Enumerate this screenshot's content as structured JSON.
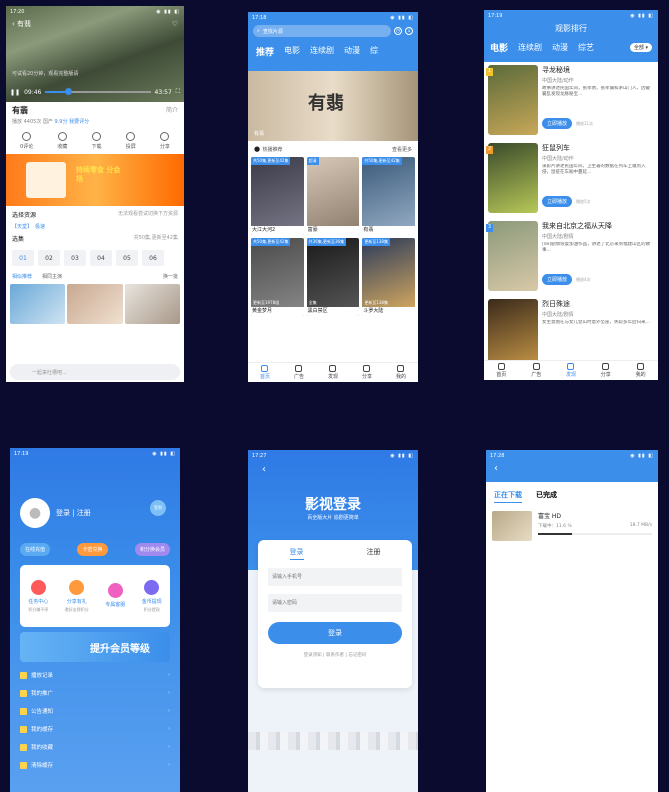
{
  "p1": {
    "status": {
      "time": "17:20"
    },
    "title": "有翡",
    "tip": "可试看20分钟，观看完整版请",
    "time_cur": "09:46",
    "time_total": "43:57",
    "progress": 0.22,
    "name": "有翡",
    "intro": "简介",
    "meta_plays": "播放 4405次",
    "meta_score_label": "国产",
    "meta_score": "9.9分",
    "meta_rate": "我要评分",
    "actions": [
      "0评论",
      "收藏",
      "下载",
      "投屏",
      "分享"
    ],
    "ad_text": "持续零食 分会场",
    "source_label": "选择资源",
    "source_hint": "无法观看尝试切换下方资源",
    "source_name": "【天堂】",
    "source_quality": "极速",
    "episodes_label": "选集",
    "episodes_more": "共50集,更新至42集",
    "episodes": [
      "01",
      "02",
      "03",
      "04",
      "05",
      "06"
    ],
    "tab_similar": "相似推荐",
    "tab_cast": "相同主演",
    "tab_refresh": "换一批",
    "comment_placeholder": "一起来吐槽吧..."
  },
  "p2": {
    "status": {
      "time": "17:18"
    },
    "search_placeholder": "查找片源",
    "tabs": [
      "推荐",
      "电影",
      "连续剧",
      "动漫",
      "综"
    ],
    "banner_title": "有翡",
    "banner_sub": "有翡",
    "section_title": "热播推荐",
    "section_more": "查看更多",
    "cards": [
      {
        "badge": "共50集,更新至42集",
        "name": "有翡",
        "ep": ""
      },
      {
        "badge": "超清",
        "name": "富豪",
        "ep": ""
      },
      {
        "badge": "共50集,更新至42集",
        "name": "有翡",
        "ep": ""
      },
      {
        "badge": "共50集,更新至42集",
        "name": "大江大河2",
        "ep": "更新至1978组"
      },
      {
        "badge": "共36集,更新至36集",
        "name": "黑白禁区",
        "ep": "全集"
      },
      {
        "badge": "更新至138集",
        "name": "斗罗大陆",
        "ep": "更新至138集"
      }
    ],
    "card_names": [
      "大江大河2",
      "富豪",
      "有翡",
      "黄金梦月",
      "黑白禁区",
      "斗罗大陆"
    ],
    "nav": [
      "首页",
      "广告",
      "发现",
      "分享",
      "我的"
    ]
  },
  "p3": {
    "status": {
      "time": "17:19"
    },
    "title": "观影排行",
    "tabs": [
      "电影",
      "连续剧",
      "动漫",
      "综艺"
    ],
    "filter": "全部",
    "items": [
      {
        "name": "寻龙秘境",
        "cat": "中国大陆/动作",
        "desc": "故事讲述民国年间，张孝驹，张孝骥和茅山门人，因破襄乱发现龙脉秘宝...",
        "btn": "立即播放",
        "hot": "播放11次"
      },
      {
        "name": "狂鼠列车",
        "cat": "中国大陆/动作",
        "desc": "谍影片讲述民国年间，卫生署的数据在列车上遭到入侵，鼠疫在车厢中蔓延...",
        "btn": "立即播放",
        "hot": "播放5次"
      },
      {
        "name": "我来自北京之福从天降",
        "cat": "中国大陆/剧情",
        "desc": "[de]剧情恢复加油作品，讲述了北京来到福建山区的故事...",
        "btn": "立即播放",
        "hot": "播放4次"
      },
      {
        "name": "烈日殊途",
        "cat": "中国大陆/剧情",
        "desc": "女主意图在与女儿登山时意外坠崖，失踪多年后归来...",
        "btn": "立即播放",
        "hot": ""
      }
    ],
    "nav": [
      "首页",
      "广告",
      "发现",
      "分享",
      "我的"
    ]
  },
  "p4": {
    "status": {
      "time": "17:19"
    },
    "login": "登录 | 注册",
    "sign": "签到",
    "pills": [
      "在线充值",
      "卡密兑换",
      "积分换会员"
    ],
    "grid": [
      {
        "label": "任务中心",
        "sub": "积分赚不停"
      },
      {
        "label": "分享有礼",
        "sub": "邀好友得积分"
      },
      {
        "label": "专属客服",
        "sub": ""
      },
      {
        "label": "金币提现",
        "sub": "积分提现"
      }
    ],
    "vip": "提升会员等级",
    "list": [
      "播放记录",
      "我的推广",
      "公告通知",
      "我的缓存",
      "我的收藏",
      "清除缓存"
    ]
  },
  "p5": {
    "status": {
      "time": "17:27"
    },
    "logo": "影视登录",
    "slogan": "百全版大片  追剧更简单",
    "tab_login": "登录",
    "tab_register": "注册",
    "phone_placeholder": "请输入手机号",
    "pwd_placeholder": "请输入密码",
    "btn_login": "登录",
    "links": "登录须知 | 联系作者 | 忘记密码"
  },
  "p6": {
    "status": {
      "time": "17:28"
    },
    "tabs": [
      "正在下载",
      "已完成"
    ],
    "item": {
      "name": "富宝 HD",
      "status": "下载中：11.6 %",
      "speed": "18.7 MB/s",
      "progress": 0.3
    }
  },
  "colors": {
    "accent": "#3b8eea",
    "bg": "#0b0b30"
  }
}
